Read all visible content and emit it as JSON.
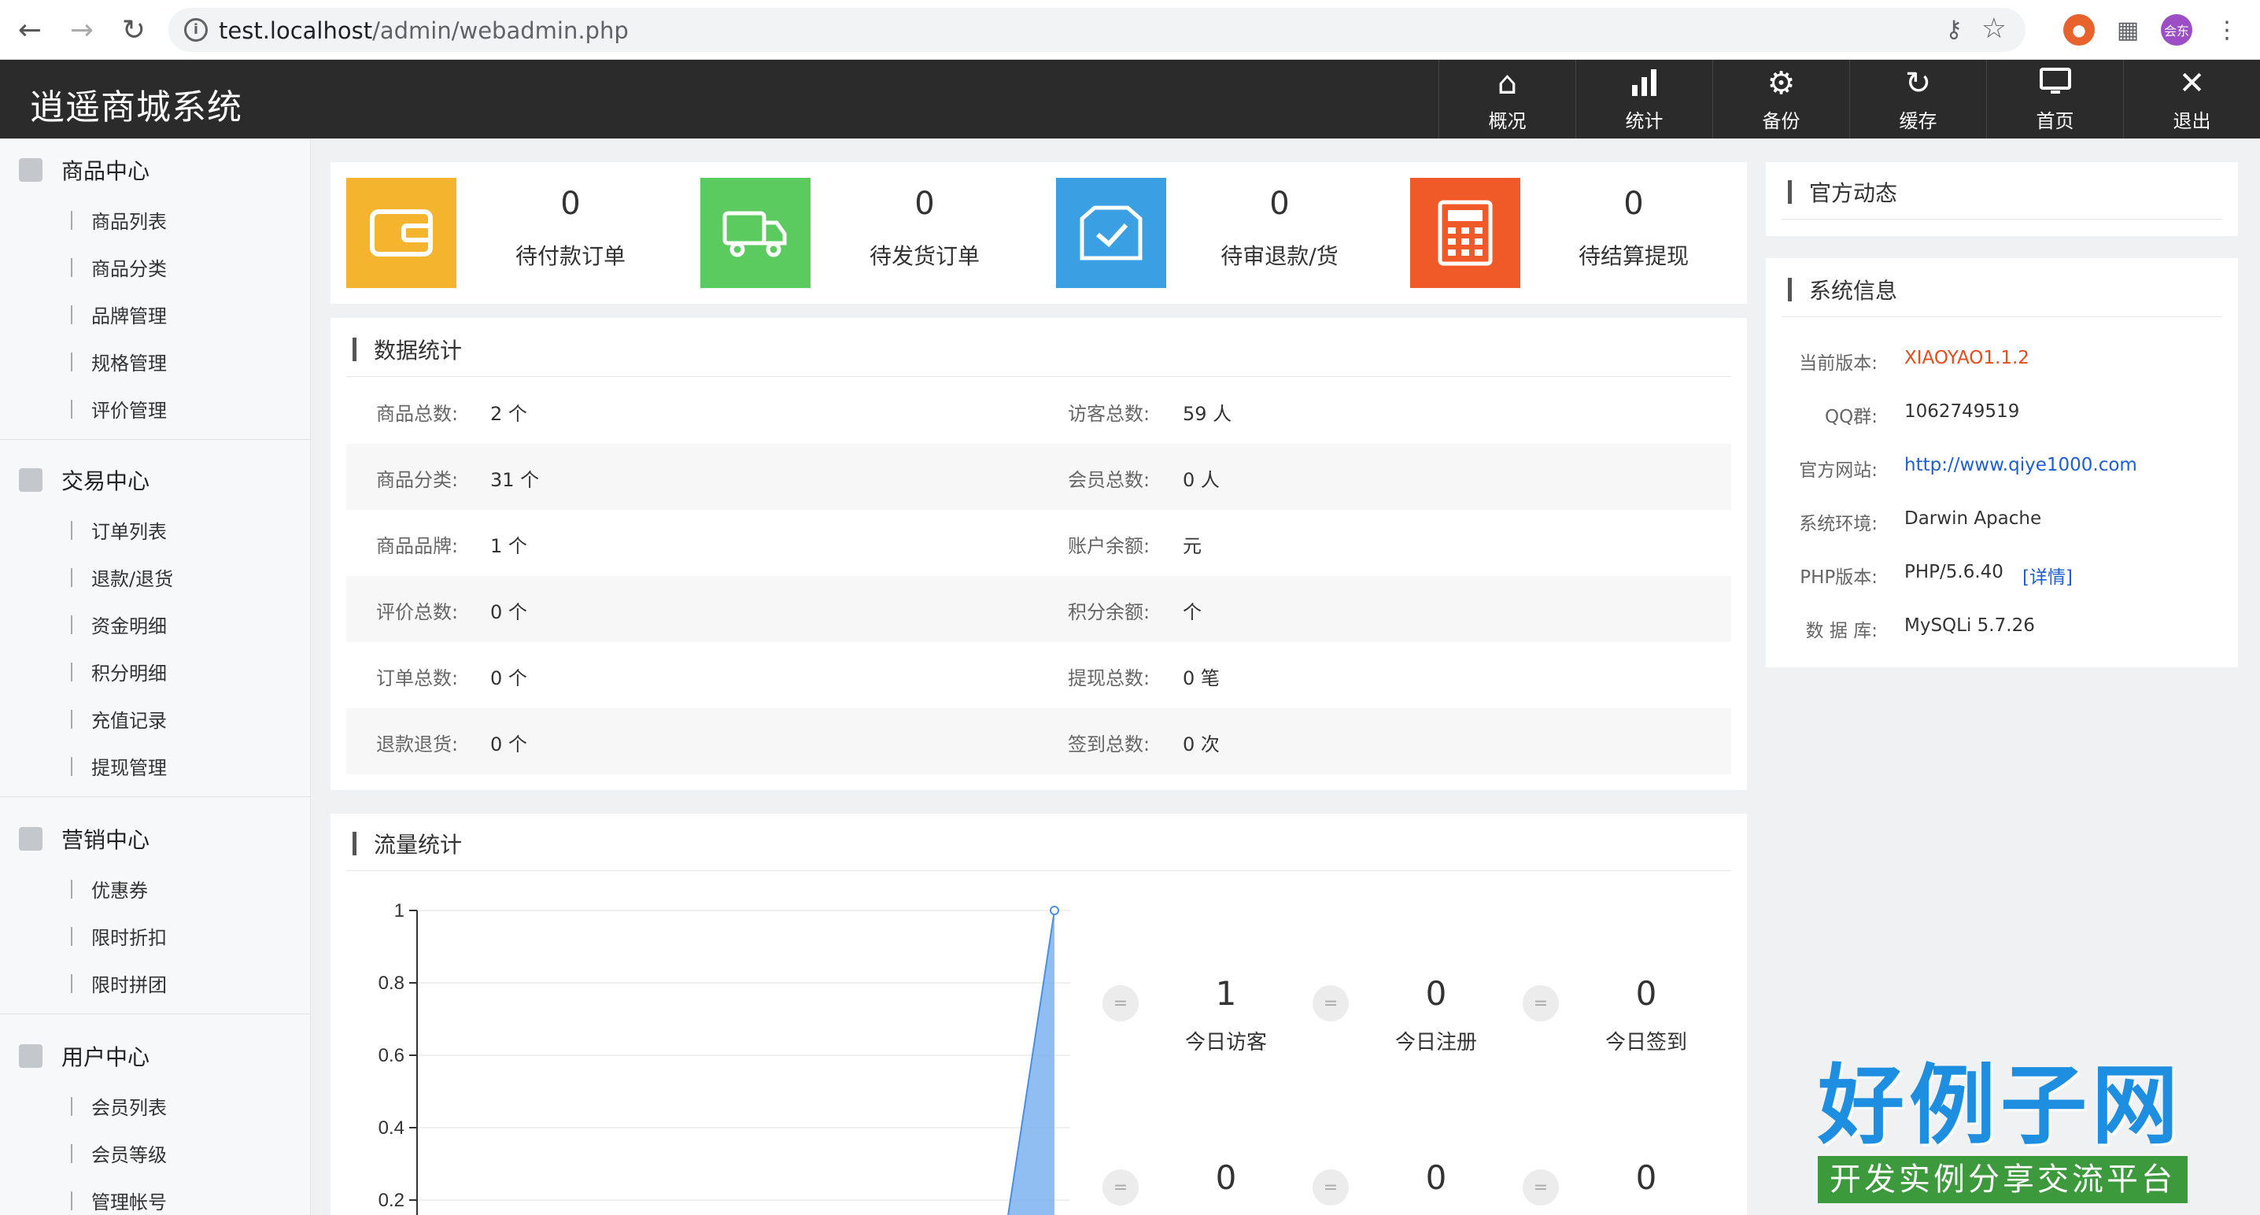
{
  "browser": {
    "url_host": "test.localhost",
    "url_path": "/admin/webadmin.php",
    "profile_label": "会东"
  },
  "app": {
    "title": "逍遥商城系统",
    "topnav": [
      {
        "label": "概况",
        "icon": "home-icon"
      },
      {
        "label": "统计",
        "icon": "bar-chart-icon"
      },
      {
        "label": "备份",
        "icon": "gear-icon"
      },
      {
        "label": "缓存",
        "icon": "refresh-icon"
      },
      {
        "label": "首页",
        "icon": "monitor-icon"
      },
      {
        "label": "退出",
        "icon": "close-icon"
      }
    ]
  },
  "sidebar": {
    "groups": [
      {
        "title": "商品中心",
        "items": [
          "商品列表",
          "商品分类",
          "品牌管理",
          "规格管理",
          "评价管理"
        ]
      },
      {
        "title": "交易中心",
        "items": [
          "订单列表",
          "退款/退货",
          "资金明细",
          "积分明细",
          "充值记录",
          "提现管理"
        ]
      },
      {
        "title": "营销中心",
        "items": [
          "优惠券",
          "限时折扣",
          "限时拼团"
        ]
      },
      {
        "title": "用户中心",
        "items": [
          "会员列表",
          "会员等级",
          "管理帐号"
        ]
      }
    ]
  },
  "stats": [
    {
      "value": "0",
      "label": "待付款订单",
      "color": "#f4b42d"
    },
    {
      "value": "0",
      "label": "待发货订单",
      "color": "#5ccb5f"
    },
    {
      "value": "0",
      "label": "待审退款/货",
      "color": "#3aa0e3"
    },
    {
      "value": "0",
      "label": "待结算提现",
      "color": "#f05a28"
    }
  ],
  "data_stats": {
    "title": "数据统计",
    "left": [
      {
        "label": "商品总数:",
        "value": "2 个"
      },
      {
        "label": "商品分类:",
        "value": "31 个"
      },
      {
        "label": "商品品牌:",
        "value": "1 个"
      },
      {
        "label": "评价总数:",
        "value": "0 个"
      },
      {
        "label": "订单总数:",
        "value": "0 个"
      },
      {
        "label": "退款退货:",
        "value": "0 个"
      }
    ],
    "right": [
      {
        "label": "访客总数:",
        "value": "59 人"
      },
      {
        "label": "会员总数:",
        "value": "0 人"
      },
      {
        "label": "账户余额:",
        "value": "元"
      },
      {
        "label": "积分余额:",
        "value": "个"
      },
      {
        "label": "提现总数:",
        "value": "0 笔"
      },
      {
        "label": "签到总数:",
        "value": "0 次"
      }
    ]
  },
  "traffic": {
    "title": "流量统计",
    "items": [
      {
        "value": "1",
        "label": "今日访客"
      },
      {
        "value": "0",
        "label": "今日注册"
      },
      {
        "value": "0",
        "label": "今日签到"
      },
      {
        "value": "0",
        "label": ""
      },
      {
        "value": "0",
        "label": ""
      },
      {
        "value": "0",
        "label": ""
      }
    ],
    "eq_symbol": "="
  },
  "chart_data": {
    "type": "area",
    "y_ticks": [
      "1",
      "0.8",
      "0.6",
      "0.4",
      "0.2"
    ],
    "ylim": [
      0,
      1
    ],
    "x": [
      0,
      1
    ],
    "values": [
      0,
      1
    ],
    "color": "#7db3f0"
  },
  "official": {
    "title": "官方动态"
  },
  "sysinfo": {
    "title": "系统信息",
    "rows": [
      {
        "label": "当前版本:",
        "value": "XIAOYAO1.1.2"
      },
      {
        "label": "QQ群:",
        "value": "1062749519"
      },
      {
        "label": "官方网站:",
        "value": "http://www.qiye1000.com"
      },
      {
        "label": "系统环境:",
        "value": "Darwin Apache"
      },
      {
        "label": "PHP版本:",
        "value": "PHP/5.6.40"
      },
      {
        "label": "数 据 库:",
        "value": "MySQLi 5.7.26"
      }
    ],
    "php_detail": "[详情]"
  },
  "watermark": {
    "big": "好例子网",
    "small": "开发实例分享交流平台"
  }
}
